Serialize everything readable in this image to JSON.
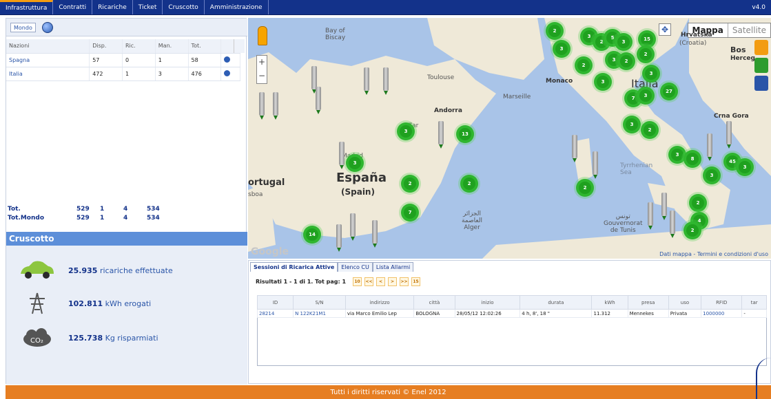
{
  "topnav": {
    "items": [
      "Infrastruttura",
      "Contratti",
      "Ricariche",
      "Ticket",
      "Cruscotto",
      "Amministrazione"
    ],
    "version": "v4.0"
  },
  "left": {
    "tab": "Mondo",
    "headers": [
      "Nazioni",
      "Disp.",
      "Ric.",
      "Man.",
      "Tot."
    ],
    "rows": [
      {
        "name": "Spagna",
        "disp": "57",
        "ric": "0",
        "man": "1",
        "tot": "58"
      },
      {
        "name": "Italia",
        "disp": "472",
        "ric": "1",
        "man": "3",
        "tot": "476"
      }
    ],
    "totals": [
      {
        "label": "Tot.",
        "disp": "529",
        "ric": "1",
        "man": "4",
        "tot": "534"
      },
      {
        "label": "Tot.Mondo",
        "disp": "529",
        "ric": "1",
        "man": "4",
        "tot": "534"
      }
    ]
  },
  "cruscotto": {
    "title": "Cruscotto",
    "stats": [
      {
        "value": "25.935",
        "label": "ricariche effettuate",
        "icon": "car-icon"
      },
      {
        "value": "102.811",
        "label": "kWh erogati",
        "icon": "pylon-icon"
      },
      {
        "value": "125.738",
        "label": "Kg risparmiati",
        "icon": "co2-cloud-icon"
      }
    ]
  },
  "map": {
    "type_selected": "Mappa",
    "type_other": "Satellite",
    "labels": {
      "bay": "Bay of\nBiscay",
      "toulouse": "Toulouse",
      "andorra": "Andorra",
      "marseille": "Marseille",
      "monaco": "Monaco",
      "espana": "España",
      "spain": "(Spain)",
      "portugal": "ortugal",
      "lisboa": "sboa",
      "hrvatska": "Hrvatska",
      "croatia": "(Croatia)",
      "bos": "Bos",
      "herceg": "Herceg",
      "crna": "Crna Gora",
      "tyrrhenian": "Tyrrhenian\nSea",
      "alger": "الجزائر\nالعاصمة\nAlger",
      "tunis": "تونس\nGouvernorat\nde Tunis",
      "italia_label": "Italia",
      "zaragoza": "Zar",
      "madrid": "Madrid"
    },
    "clusters": [
      "2",
      "3",
      "3",
      "2",
      "5",
      "3",
      "15",
      "2",
      "2",
      "3",
      "2",
      "3",
      "3",
      "27",
      "7",
      "3",
      "3",
      "13",
      "3",
      "2",
      "3",
      "3",
      "8",
      "45",
      "3",
      "3",
      "2",
      "2",
      "2",
      "2",
      "7",
      "4",
      "2",
      "5",
      "3",
      "14",
      "3",
      "2"
    ],
    "footer": "Dati mappa - Termini e condizioni d'uso",
    "google": "Google"
  },
  "sessions": {
    "tabs": [
      "Sessioni di Ricarica Attive",
      "Elenco CU",
      "Lista Allarmi"
    ],
    "results": "Risultati 1 - 1 di 1. Tot pag: 1",
    "pager_buttons": [
      "10",
      "<<",
      "<",
      ">",
      ">>",
      "15"
    ],
    "headers": [
      "ID",
      "S/N",
      "indirizzo",
      "città",
      "inizio",
      "durata",
      "kWh",
      "presa",
      "uso",
      "RFID",
      "tar"
    ],
    "rows": [
      {
        "id": "28214",
        "sn": "N 122K21M1",
        "indirizzo": "via Marco Emilio Lep",
        "citta": "BOLOGNA",
        "inizio": "28/05/12 12:02:26",
        "durata": "4 h, 8', 18 \"",
        "kwh": "11.312",
        "presa": "Mennekes",
        "uso": "Privata",
        "rfid": "1000000",
        "tar": "-"
      }
    ]
  },
  "footer": "Tutti i diritti riservati © Enel 2012"
}
